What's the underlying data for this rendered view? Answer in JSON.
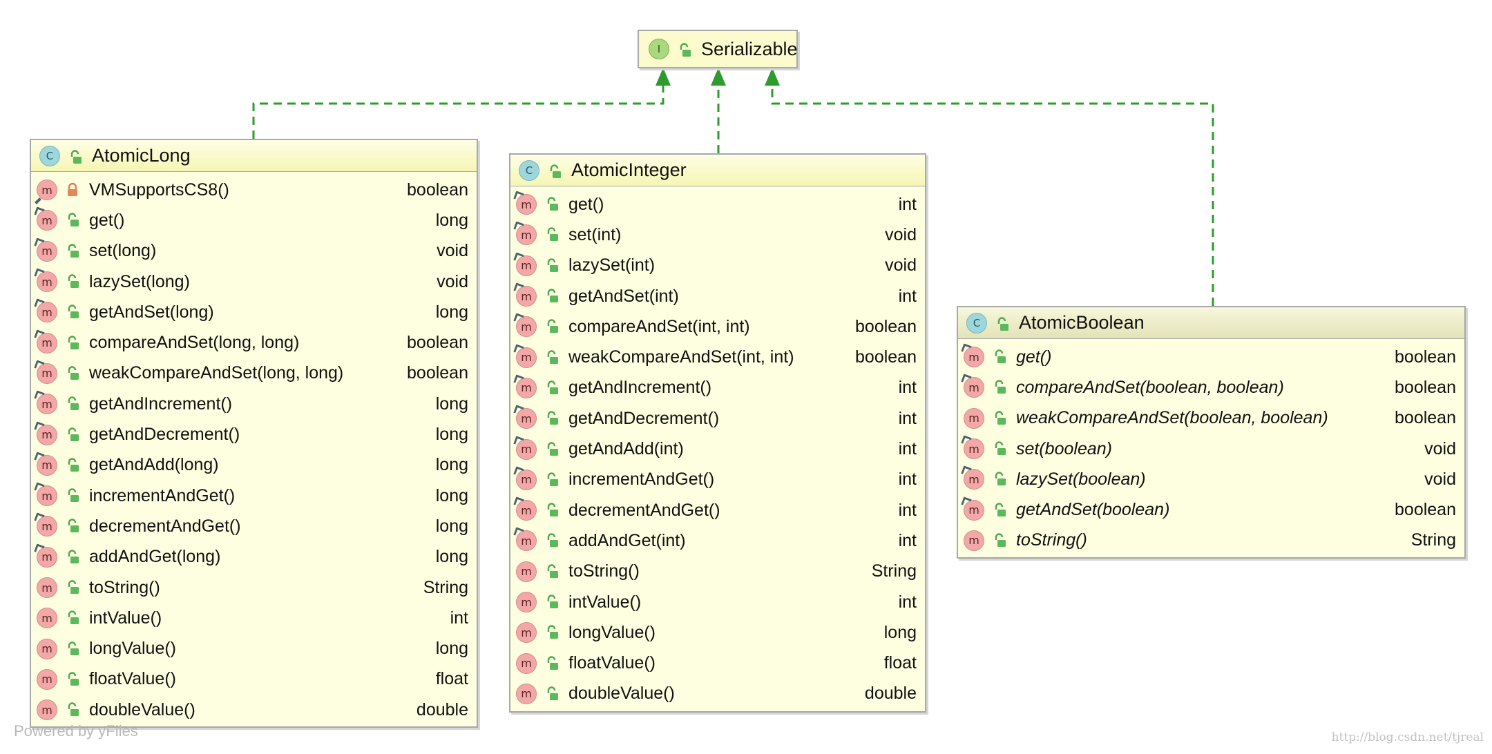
{
  "colors": {
    "node_fill": "#fefee0",
    "header_fill": "#f6f6b4",
    "border": "#a8a8a8",
    "arrow": "#2e9b2e",
    "class_badge": "#9ed6da",
    "interface_badge": "#a9d87e",
    "method_badge": "#f3a8a8"
  },
  "diagram": {
    "interface": {
      "name": "Serializable",
      "kind_letter": "I"
    },
    "classes": [
      {
        "name": "AtomicLong",
        "kind_letter": "C",
        "italic": false,
        "methods": [
          {
            "name": "VMSupportsCS8()",
            "type": "boolean",
            "visibility": "private",
            "badge": "m",
            "marker": "impl"
          },
          {
            "name": "get()",
            "type": "long",
            "visibility": "public",
            "badge": "m",
            "marker": "override"
          },
          {
            "name": "set(long)",
            "type": "void",
            "visibility": "public",
            "badge": "m",
            "marker": "override"
          },
          {
            "name": "lazySet(long)",
            "type": "void",
            "visibility": "public",
            "badge": "m",
            "marker": "override"
          },
          {
            "name": "getAndSet(long)",
            "type": "long",
            "visibility": "public",
            "badge": "m",
            "marker": "override"
          },
          {
            "name": "compareAndSet(long, long)",
            "type": "boolean",
            "visibility": "public",
            "badge": "m",
            "marker": "override"
          },
          {
            "name": "weakCompareAndSet(long, long)",
            "type": "boolean",
            "visibility": "public",
            "badge": "m",
            "marker": "override"
          },
          {
            "name": "getAndIncrement()",
            "type": "long",
            "visibility": "public",
            "badge": "m",
            "marker": "override"
          },
          {
            "name": "getAndDecrement()",
            "type": "long",
            "visibility": "public",
            "badge": "m",
            "marker": "override"
          },
          {
            "name": "getAndAdd(long)",
            "type": "long",
            "visibility": "public",
            "badge": "m",
            "marker": "override"
          },
          {
            "name": "incrementAndGet()",
            "type": "long",
            "visibility": "public",
            "badge": "m",
            "marker": "override"
          },
          {
            "name": "decrementAndGet()",
            "type": "long",
            "visibility": "public",
            "badge": "m",
            "marker": "override"
          },
          {
            "name": "addAndGet(long)",
            "type": "long",
            "visibility": "public",
            "badge": "m",
            "marker": "override"
          },
          {
            "name": "toString()",
            "type": "String",
            "visibility": "public",
            "badge": "m",
            "marker": "none"
          },
          {
            "name": "intValue()",
            "type": "int",
            "visibility": "public",
            "badge": "m",
            "marker": "none"
          },
          {
            "name": "longValue()",
            "type": "long",
            "visibility": "public",
            "badge": "m",
            "marker": "none"
          },
          {
            "name": "floatValue()",
            "type": "float",
            "visibility": "public",
            "badge": "m",
            "marker": "none"
          },
          {
            "name": "doubleValue()",
            "type": "double",
            "visibility": "public",
            "badge": "m",
            "marker": "none"
          }
        ]
      },
      {
        "name": "AtomicInteger",
        "kind_letter": "C",
        "italic": false,
        "methods": [
          {
            "name": "get()",
            "type": "int",
            "visibility": "public",
            "badge": "m",
            "marker": "override"
          },
          {
            "name": "set(int)",
            "type": "void",
            "visibility": "public",
            "badge": "m",
            "marker": "override"
          },
          {
            "name": "lazySet(int)",
            "type": "void",
            "visibility": "public",
            "badge": "m",
            "marker": "override"
          },
          {
            "name": "getAndSet(int)",
            "type": "int",
            "visibility": "public",
            "badge": "m",
            "marker": "override"
          },
          {
            "name": "compareAndSet(int, int)",
            "type": "boolean",
            "visibility": "public",
            "badge": "m",
            "marker": "override"
          },
          {
            "name": "weakCompareAndSet(int, int)",
            "type": "boolean",
            "visibility": "public",
            "badge": "m",
            "marker": "override"
          },
          {
            "name": "getAndIncrement()",
            "type": "int",
            "visibility": "public",
            "badge": "m",
            "marker": "override"
          },
          {
            "name": "getAndDecrement()",
            "type": "int",
            "visibility": "public",
            "badge": "m",
            "marker": "override"
          },
          {
            "name": "getAndAdd(int)",
            "type": "int",
            "visibility": "public",
            "badge": "m",
            "marker": "override"
          },
          {
            "name": "incrementAndGet()",
            "type": "int",
            "visibility": "public",
            "badge": "m",
            "marker": "override"
          },
          {
            "name": "decrementAndGet()",
            "type": "int",
            "visibility": "public",
            "badge": "m",
            "marker": "override"
          },
          {
            "name": "addAndGet(int)",
            "type": "int",
            "visibility": "public",
            "badge": "m",
            "marker": "override"
          },
          {
            "name": "toString()",
            "type": "String",
            "visibility": "public",
            "badge": "m",
            "marker": "none"
          },
          {
            "name": "intValue()",
            "type": "int",
            "visibility": "public",
            "badge": "m",
            "marker": "none"
          },
          {
            "name": "longValue()",
            "type": "long",
            "visibility": "public",
            "badge": "m",
            "marker": "none"
          },
          {
            "name": "floatValue()",
            "type": "float",
            "visibility": "public",
            "badge": "m",
            "marker": "none"
          },
          {
            "name": "doubleValue()",
            "type": "double",
            "visibility": "public",
            "badge": "m",
            "marker": "none"
          }
        ]
      },
      {
        "name": "AtomicBoolean",
        "kind_letter": "C",
        "italic": true,
        "methods": [
          {
            "name": "get()",
            "type": "boolean",
            "visibility": "public",
            "badge": "m",
            "marker": "override"
          },
          {
            "name": "compareAndSet(boolean, boolean)",
            "type": "boolean",
            "visibility": "public",
            "badge": "m",
            "marker": "override"
          },
          {
            "name": "weakCompareAndSet(boolean, boolean)",
            "type": "boolean",
            "visibility": "public",
            "badge": "m",
            "marker": "none"
          },
          {
            "name": "set(boolean)",
            "type": "void",
            "visibility": "public",
            "badge": "m",
            "marker": "override"
          },
          {
            "name": "lazySet(boolean)",
            "type": "void",
            "visibility": "public",
            "badge": "m",
            "marker": "override"
          },
          {
            "name": "getAndSet(boolean)",
            "type": "boolean",
            "visibility": "public",
            "badge": "m",
            "marker": "override"
          },
          {
            "name": "toString()",
            "type": "String",
            "visibility": "public",
            "badge": "m",
            "marker": "none"
          }
        ]
      }
    ]
  },
  "watermark": "Powered by yFiles",
  "source_url": "http://blog.csdn.net/tjreal"
}
